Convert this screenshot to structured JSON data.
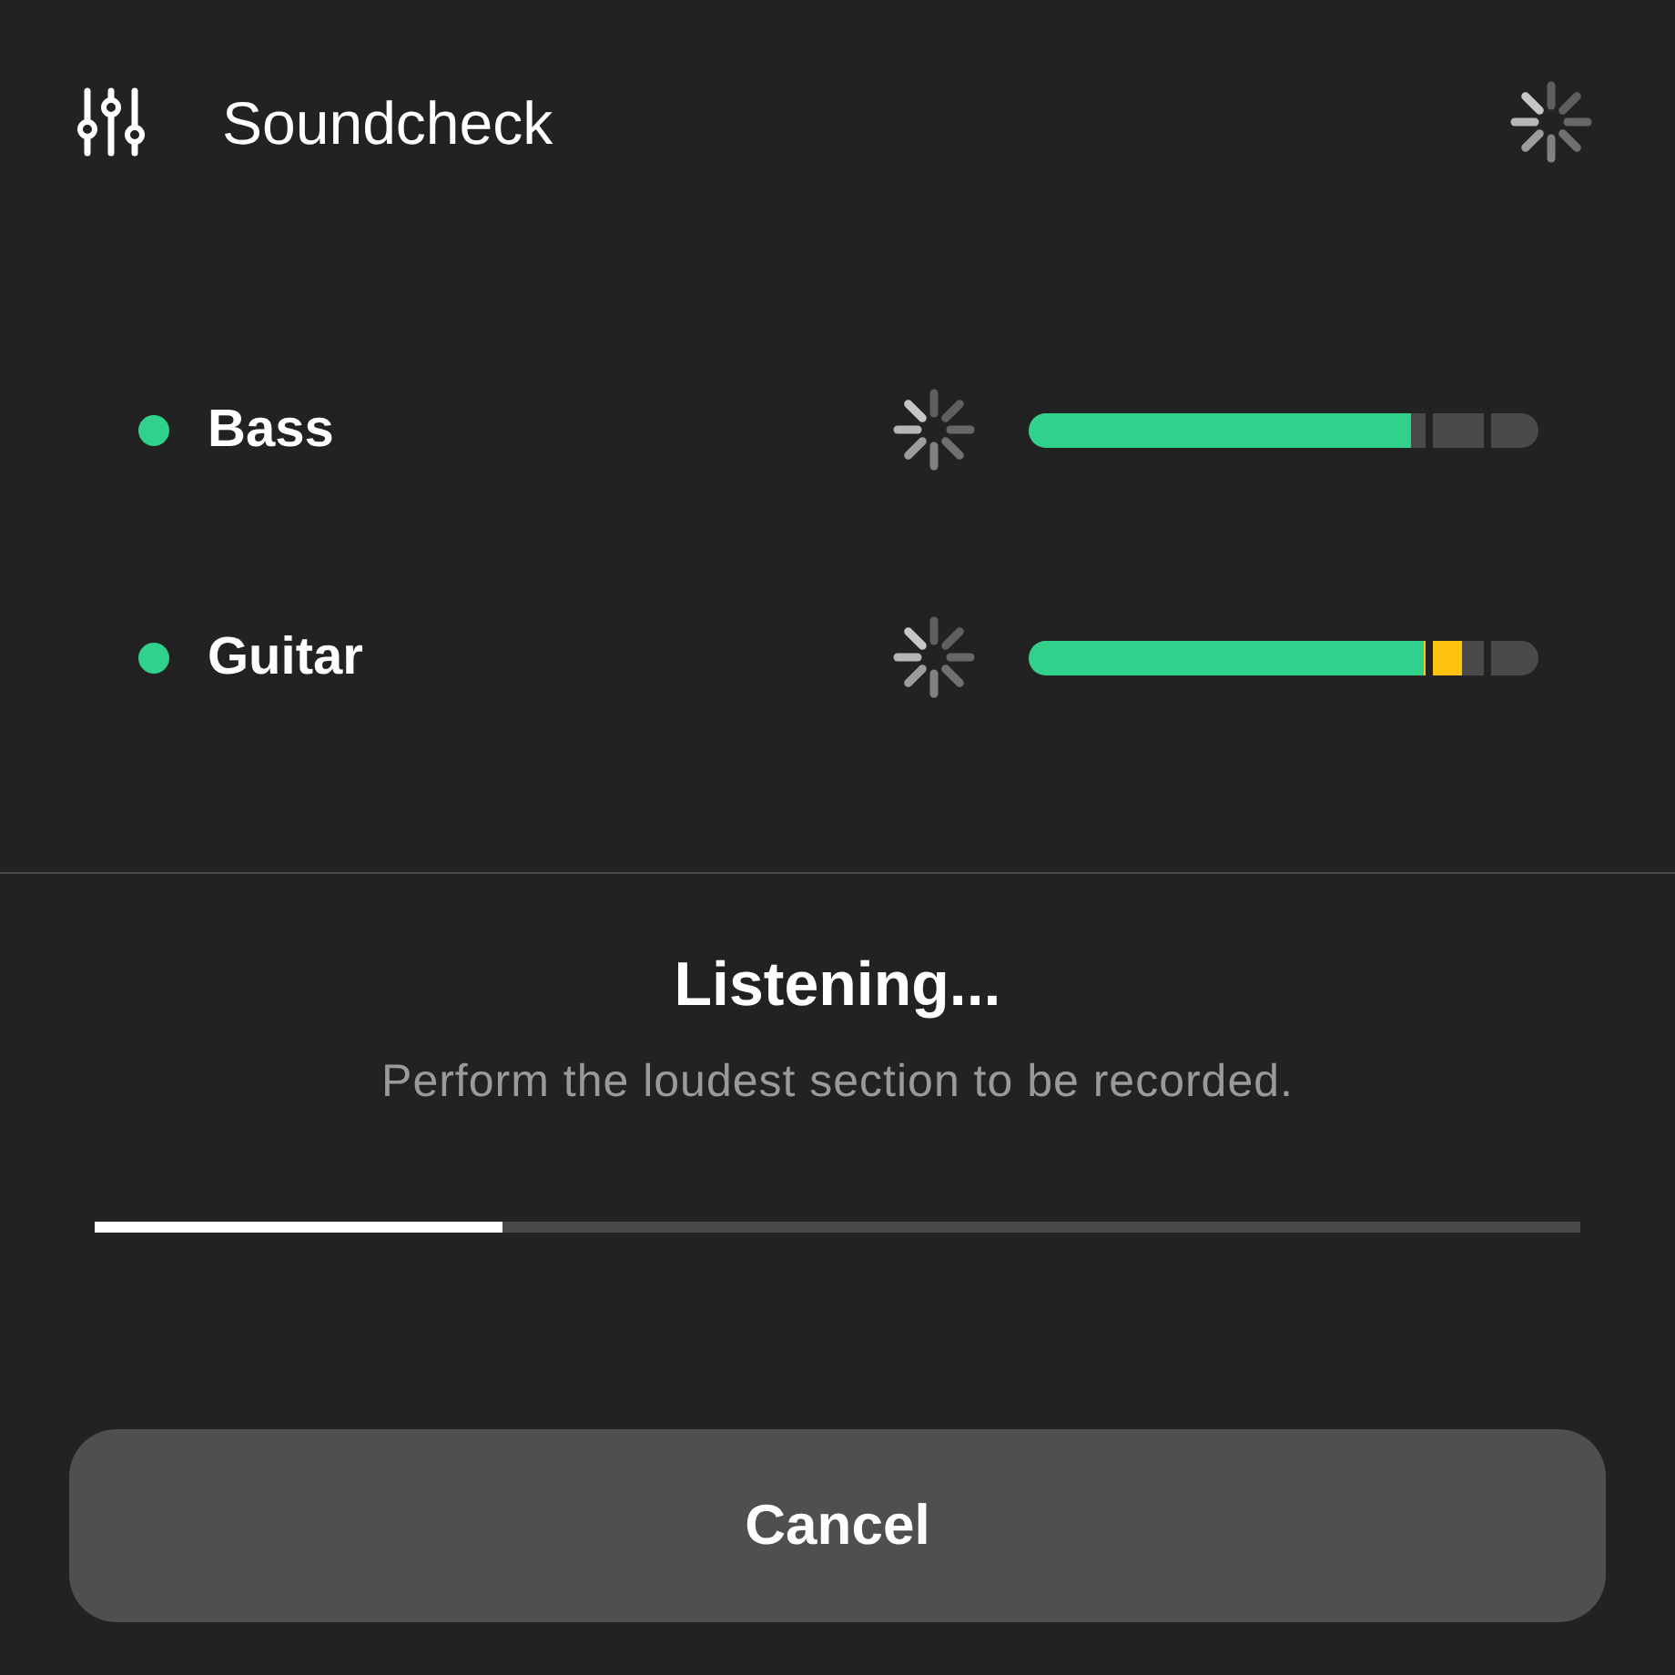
{
  "header": {
    "title": "Soundcheck"
  },
  "channels": [
    {
      "name": "Bass",
      "color": "#2fd18b",
      "level": 0.75
    },
    {
      "name": "Guitar",
      "color": "#2fd18b",
      "level": 0.85
    }
  ],
  "status": {
    "title": "Listening...",
    "message": "Perform the loudest section to be recorded.",
    "level": 0.275
  },
  "buttons": [
    "Cancel"
  ]
}
